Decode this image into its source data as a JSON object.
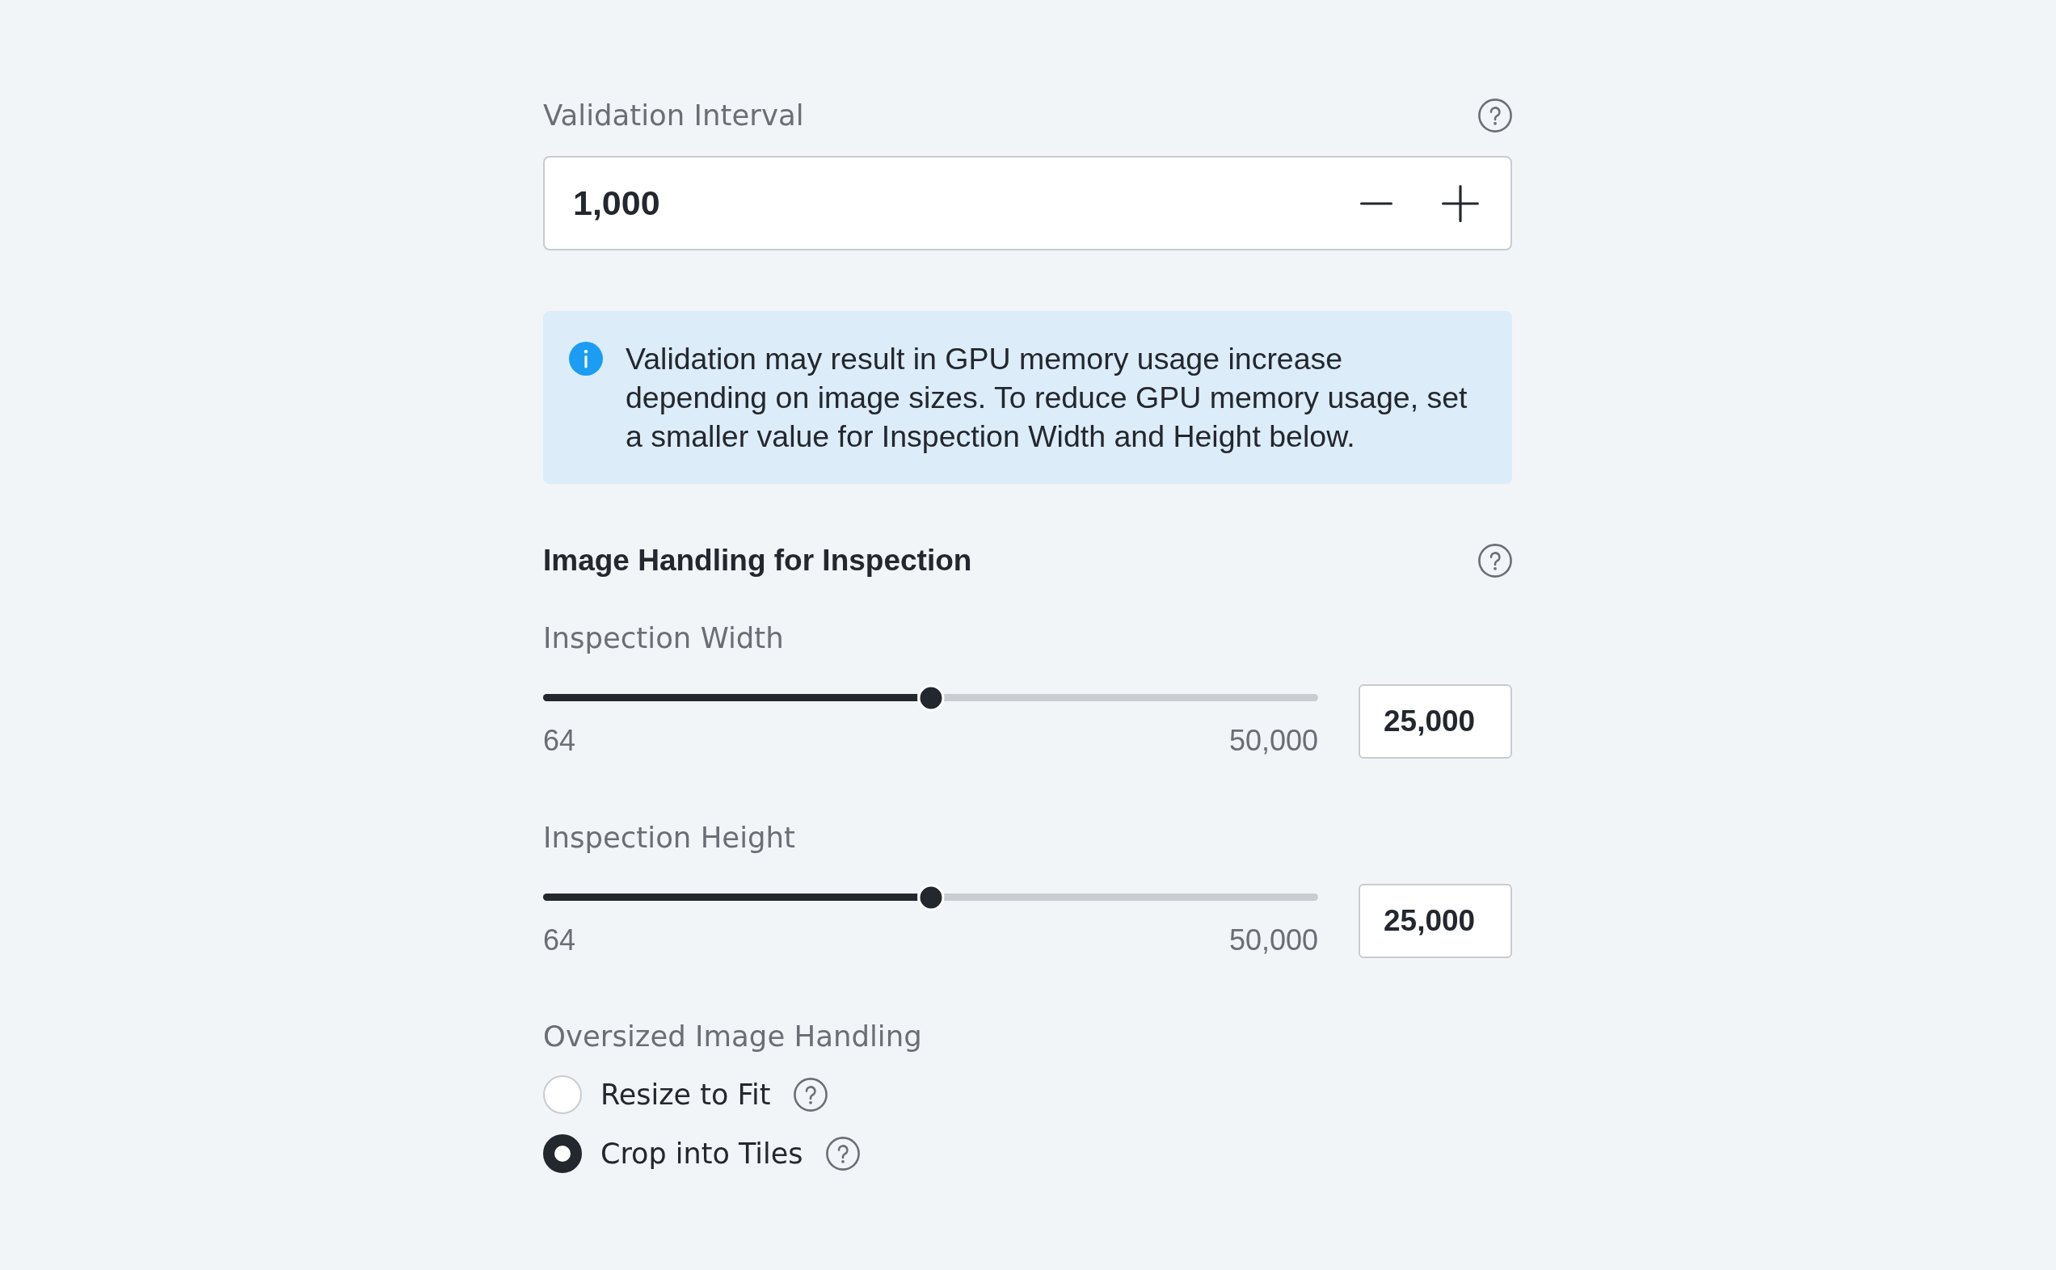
{
  "validation_interval": {
    "label": "Validation Interval",
    "help_icon": true,
    "value": "1,000"
  },
  "info_banner": {
    "text": "Validation may result in GPU memory usage increase depending on image sizes. To reduce GPU memory usage, set a smaller value for Inspection Width and Height below."
  },
  "image_handling": {
    "title": "Image Handling for Inspection",
    "help_icon": true,
    "sliders": [
      {
        "label": "Inspection Width",
        "level": 0.5,
        "min": "64",
        "max": "50,000",
        "value": "25,000"
      },
      {
        "label": "Inspection Height",
        "level": 0.5,
        "min": "64",
        "max": "50,000",
        "value": "25,000"
      }
    ],
    "oversized_handling": {
      "label": "Oversized Image Handling",
      "options": [
        {
          "label": "Resize to Fit",
          "selected": false,
          "help_icon": true
        },
        {
          "label": "Crop into Tiles",
          "selected": true,
          "help_icon": true
        }
      ]
    }
  }
}
